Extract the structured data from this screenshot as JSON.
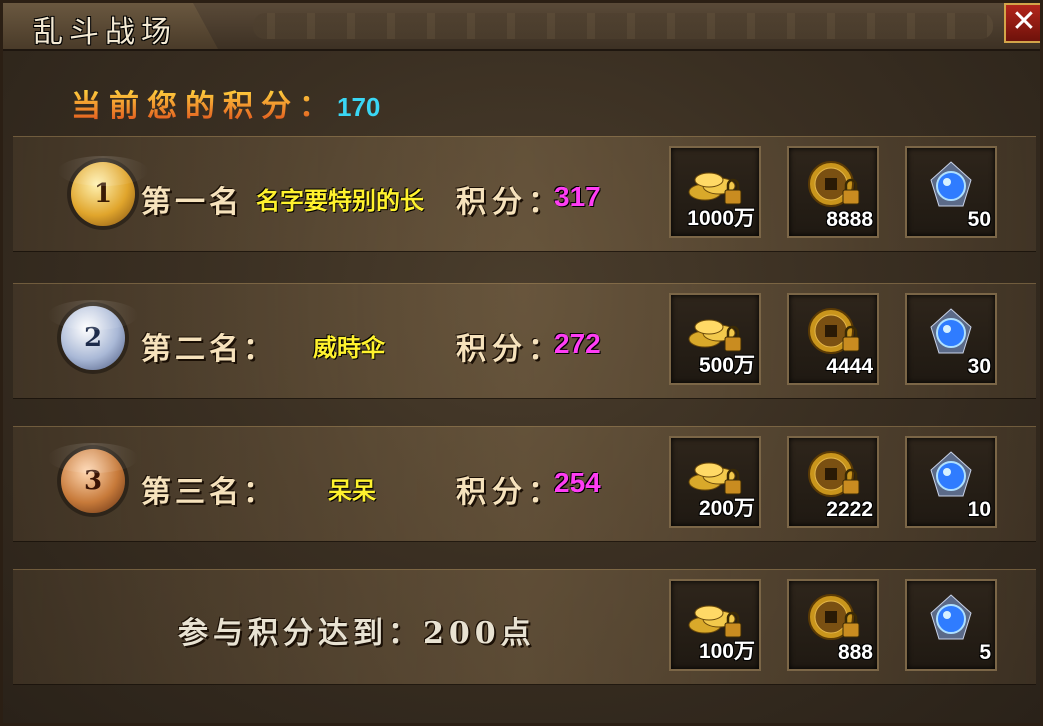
{
  "window": {
    "title": "乱斗战场",
    "close_label": "✕"
  },
  "current_score": {
    "label": "当前您的积分：",
    "value": "170"
  },
  "ranks": [
    {
      "medal": "1",
      "label": "第一名",
      "player": "名字要特别的长",
      "score_label": "积分：",
      "score": "317",
      "rewards": [
        "1000万",
        "8888",
        "50"
      ]
    },
    {
      "medal": "2",
      "label": "第二名：",
      "player": "威時伞",
      "score_label": "积分：",
      "score": "272",
      "rewards": [
        "500万",
        "4444",
        "30"
      ]
    },
    {
      "medal": "3",
      "label": "第三名：",
      "player": "呆呆",
      "score_label": "积分：",
      "score": "254",
      "rewards": [
        "200万",
        "2222",
        "10"
      ]
    }
  ],
  "participation": {
    "label": "参与积分达到：200点",
    "rewards": [
      "100万",
      "888",
      "5"
    ]
  },
  "icons": [
    "gold-coins-icon",
    "copper-coin-lock-icon",
    "blue-crystal-icon"
  ],
  "colors": {
    "player_name": "#fff22e",
    "score_value": "#ff3df4",
    "current_score_value": "#3ad7f5"
  }
}
